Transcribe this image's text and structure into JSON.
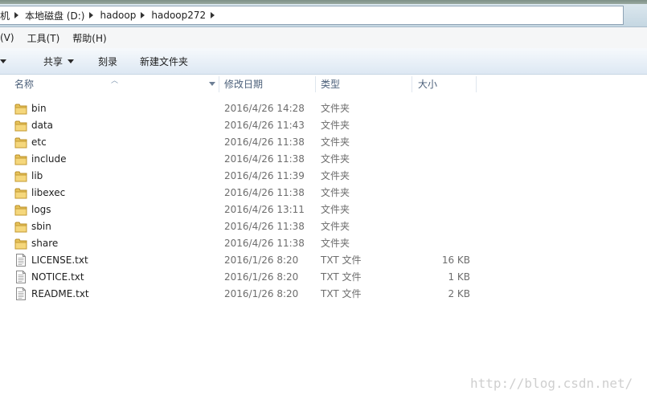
{
  "address": {
    "crumbs": [
      "机",
      "本地磁盘 (D:)",
      "hadoop",
      "hadoop272"
    ]
  },
  "menu": {
    "items": [
      "(V)",
      "工具(T)",
      "帮助(H)"
    ]
  },
  "toolbar": {
    "share_label": "共享",
    "burn_label": "刻录",
    "new_folder_label": "新建文件夹"
  },
  "columns": {
    "name": "名称",
    "date": "修改日期",
    "type": "类型",
    "size": "大小"
  },
  "files": [
    {
      "icon": "folder-icon",
      "name": "bin",
      "date": "2016/4/26 14:28",
      "type": "文件夹",
      "size": ""
    },
    {
      "icon": "folder-icon",
      "name": "data",
      "date": "2016/4/26 11:43",
      "type": "文件夹",
      "size": ""
    },
    {
      "icon": "folder-icon",
      "name": "etc",
      "date": "2016/4/26 11:38",
      "type": "文件夹",
      "size": ""
    },
    {
      "icon": "folder-icon",
      "name": "include",
      "date": "2016/4/26 11:38",
      "type": "文件夹",
      "size": ""
    },
    {
      "icon": "folder-icon",
      "name": "lib",
      "date": "2016/4/26 11:39",
      "type": "文件夹",
      "size": ""
    },
    {
      "icon": "folder-icon",
      "name": "libexec",
      "date": "2016/4/26 11:38",
      "type": "文件夹",
      "size": ""
    },
    {
      "icon": "folder-icon",
      "name": "logs",
      "date": "2016/4/26 13:11",
      "type": "文件夹",
      "size": ""
    },
    {
      "icon": "folder-icon",
      "name": "sbin",
      "date": "2016/4/26 11:38",
      "type": "文件夹",
      "size": ""
    },
    {
      "icon": "folder-icon",
      "name": "share",
      "date": "2016/4/26 11:38",
      "type": "文件夹",
      "size": ""
    },
    {
      "icon": "file-icon",
      "name": "LICENSE.txt",
      "date": "2016/1/26 8:20",
      "type": "TXT 文件",
      "size": "16 KB"
    },
    {
      "icon": "file-icon",
      "name": "NOTICE.txt",
      "date": "2016/1/26 8:20",
      "type": "TXT 文件",
      "size": "1 KB"
    },
    {
      "icon": "file-icon",
      "name": "README.txt",
      "date": "2016/1/26 8:20",
      "type": "TXT 文件",
      "size": "2 KB"
    }
  ],
  "watermark": "http://blog.csdn.net/"
}
